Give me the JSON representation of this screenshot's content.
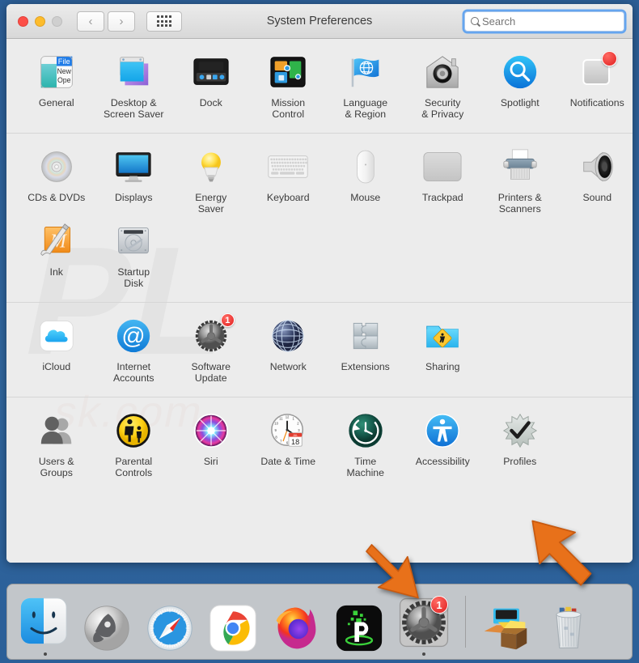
{
  "window": {
    "title": "System Preferences",
    "traffic_lights": [
      "close-button",
      "minimize-button",
      "zoom-button-disabled"
    ],
    "nav": {
      "back_label": "‹",
      "forward_label": "›",
      "grid_label": "show-all-grid"
    },
    "search": {
      "placeholder": "Search",
      "value": "",
      "focus_color": "#65a5ef"
    }
  },
  "sections": [
    {
      "name": "personal",
      "rows": [
        [
          {
            "label": "General",
            "icon": "general-icon"
          },
          {
            "label": "Desktop &\nScreen Saver",
            "icon": "desktop-screensaver-icon"
          },
          {
            "label": "Dock",
            "icon": "dock-icon"
          },
          {
            "label": "Mission\nControl",
            "icon": "mission-control-icon"
          },
          {
            "label": "Language\n& Region",
            "icon": "language-region-icon"
          },
          {
            "label": "Security\n& Privacy",
            "icon": "security-privacy-icon"
          },
          {
            "label": "Spotlight",
            "icon": "spotlight-icon"
          },
          {
            "label": "Notifications",
            "icon": "notifications-icon",
            "badge": "dot"
          }
        ]
      ]
    },
    {
      "name": "hardware",
      "rows": [
        [
          {
            "label": "CDs & DVDs",
            "icon": "cds-dvds-icon"
          },
          {
            "label": "Displays",
            "icon": "displays-icon"
          },
          {
            "label": "Energy\nSaver",
            "icon": "energy-saver-icon"
          },
          {
            "label": "Keyboard",
            "icon": "keyboard-icon"
          },
          {
            "label": "Mouse",
            "icon": "mouse-icon"
          },
          {
            "label": "Trackpad",
            "icon": "trackpad-icon"
          },
          {
            "label": "Printers &\nScanners",
            "icon": "printers-scanners-icon"
          },
          {
            "label": "Sound",
            "icon": "sound-icon"
          }
        ],
        [
          {
            "label": "Ink",
            "icon": "ink-icon"
          },
          {
            "label": "Startup\nDisk",
            "icon": "startup-disk-icon"
          }
        ]
      ]
    },
    {
      "name": "internet-wireless",
      "rows": [
        [
          {
            "label": "iCloud",
            "icon": "icloud-icon"
          },
          {
            "label": "Internet\nAccounts",
            "icon": "internet-accounts-icon"
          },
          {
            "label": "Software\nUpdate",
            "icon": "software-update-icon",
            "badge": "1"
          },
          {
            "label": "Network",
            "icon": "network-icon"
          },
          {
            "label": "Extensions",
            "icon": "extensions-icon"
          },
          {
            "label": "Sharing",
            "icon": "sharing-icon"
          }
        ]
      ]
    },
    {
      "name": "system",
      "rows": [
        [
          {
            "label": "Users &\nGroups",
            "icon": "users-groups-icon"
          },
          {
            "label": "Parental\nControls",
            "icon": "parental-controls-icon"
          },
          {
            "label": "Siri",
            "icon": "siri-icon"
          },
          {
            "label": "Date & Time",
            "icon": "date-time-icon",
            "calendar_day": "18",
            "calendar_month": "JUL"
          },
          {
            "label": "Time\nMachine",
            "icon": "time-machine-icon"
          },
          {
            "label": "Accessibility",
            "icon": "accessibility-icon"
          },
          {
            "label": "Profiles",
            "icon": "profiles-icon"
          }
        ]
      ]
    }
  ],
  "dock": {
    "items": [
      {
        "name": "finder",
        "icon": "finder-icon",
        "running": true
      },
      {
        "name": "launchpad",
        "icon": "launchpad-icon",
        "running": false
      },
      {
        "name": "safari",
        "icon": "safari-icon",
        "running": false
      },
      {
        "name": "chrome",
        "icon": "chrome-icon",
        "running": false
      },
      {
        "name": "firefox",
        "icon": "firefox-icon",
        "running": false
      },
      {
        "name": "ipvanish",
        "icon": "ipvanish-icon",
        "running": false
      },
      {
        "name": "system-preferences",
        "icon": "system-preferences-icon",
        "running": true,
        "badge": "1"
      }
    ],
    "right_items": [
      {
        "name": "downloads-stack",
        "icon": "downloads-stack-icon"
      },
      {
        "name": "trash",
        "icon": "trash-icon"
      }
    ]
  },
  "annotations": {
    "arrows": [
      {
        "name": "arrow-pointing-to-dock-system-preferences",
        "color": "#E8711A",
        "direction": "down-right"
      },
      {
        "name": "arrow-pointing-to-profiles",
        "color": "#E8711A",
        "direction": "up-left"
      }
    ]
  },
  "watermark": {
    "text": "PL",
    "sub": "sk.com"
  }
}
